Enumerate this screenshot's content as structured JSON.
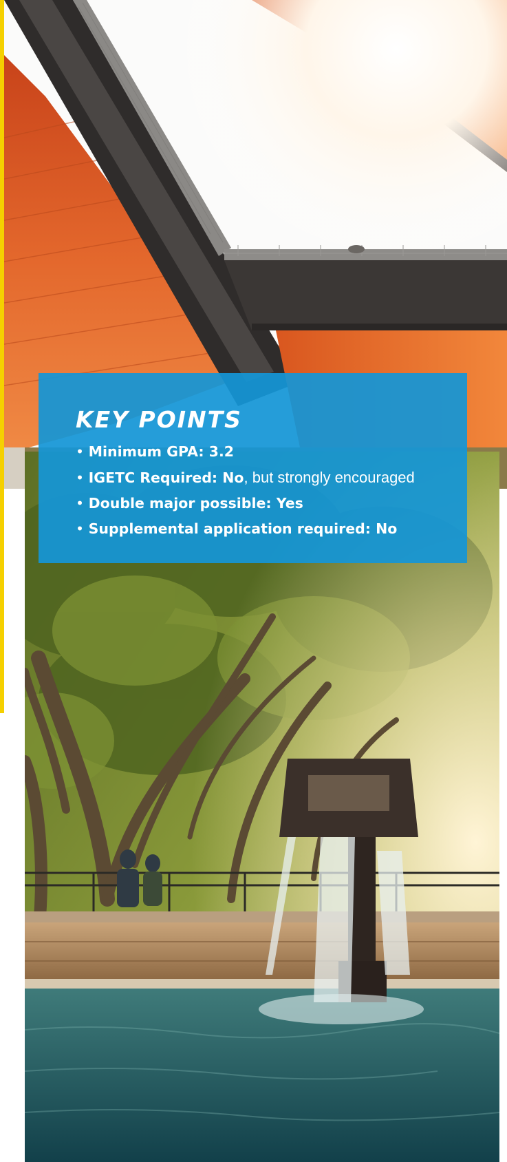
{
  "key_points": {
    "title": "KEY POINTS",
    "items": [
      {
        "bullet": "•",
        "label": "Minimum GPA: 3.2",
        "note": ""
      },
      {
        "bullet": "•",
        "label": "IGETC Required: No",
        "note": ", but strongly encouraged"
      },
      {
        "bullet": "•",
        "label": "Double major possible: Yes",
        "note": ""
      },
      {
        "bullet": "•",
        "label": "Supplemental application required: No",
        "note": ""
      }
    ]
  },
  "colors": {
    "accent_yellow": "#f5d000",
    "key_box_blue": "#1496d6",
    "canopy_orange": "#e0622a"
  }
}
